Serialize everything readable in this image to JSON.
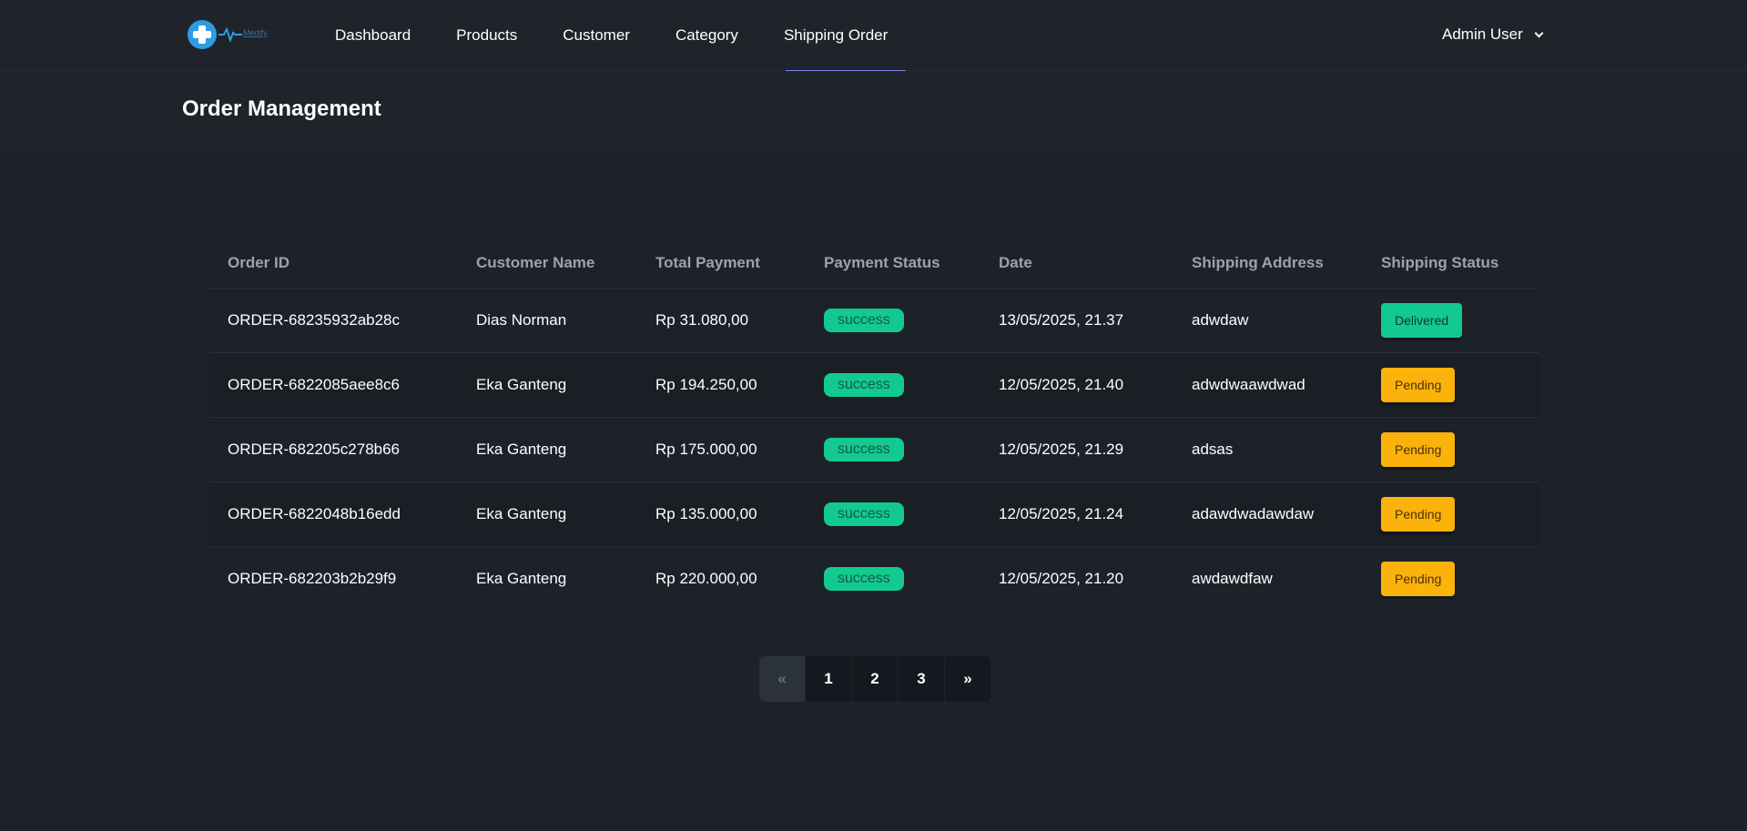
{
  "nav": {
    "logo_text": "Medify",
    "items": [
      {
        "label": "Dashboard"
      },
      {
        "label": "Products"
      },
      {
        "label": "Customer"
      },
      {
        "label": "Category"
      },
      {
        "label": "Shipping Order"
      }
    ],
    "active": "Shipping Order",
    "user": "Admin User"
  },
  "page": {
    "title": "Order Management"
  },
  "table": {
    "headers": [
      "Order ID",
      "Customer Name",
      "Total Payment",
      "Payment Status",
      "Date",
      "Shipping Address",
      "Shipping Status"
    ],
    "rows": [
      {
        "order_id": "ORDER-68235932ab28c",
        "customer": "Dias Norman",
        "total": "Rp 31.080,00",
        "payment_status": "success",
        "date": "13/05/2025, 21.37",
        "address": "adwdaw",
        "shipping_status": "Delivered"
      },
      {
        "order_id": "ORDER-6822085aee8c6",
        "customer": "Eka Ganteng",
        "total": "Rp 194.250,00",
        "payment_status": "success",
        "date": "12/05/2025, 21.40",
        "address": "adwdwaawdwad",
        "shipping_status": "Pending"
      },
      {
        "order_id": "ORDER-682205c278b66",
        "customer": "Eka Ganteng",
        "total": "Rp 175.000,00",
        "payment_status": "success",
        "date": "12/05/2025, 21.29",
        "address": "adsas",
        "shipping_status": "Pending"
      },
      {
        "order_id": "ORDER-6822048b16edd",
        "customer": "Eka Ganteng",
        "total": "Rp 135.000,00",
        "payment_status": "success",
        "date": "12/05/2025, 21.24",
        "address": "adawdwadawdaw",
        "shipping_status": "Pending"
      },
      {
        "order_id": "ORDER-682203b2b29f9",
        "customer": "Eka Ganteng",
        "total": "Rp 220.000,00",
        "payment_status": "success",
        "date": "12/05/2025, 21.20",
        "address": "awdawdfaw",
        "shipping_status": "Pending"
      }
    ]
  },
  "pagination": {
    "prev": "«",
    "pages": [
      "1",
      "2",
      "3"
    ],
    "next": "»"
  },
  "colors": {
    "background": "#1d222a",
    "accent_underline": "#7c86f5",
    "success": "#12c98f",
    "pending": "#fbb20a"
  }
}
